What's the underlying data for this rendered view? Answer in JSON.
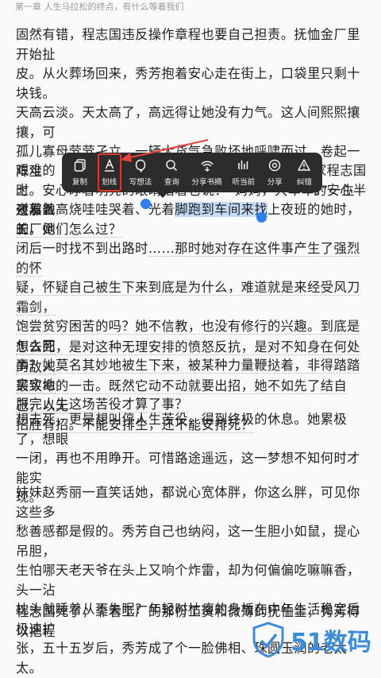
{
  "header": {
    "title": "第一章 人生马拉松的终点，有什么等着我们"
  },
  "paragraphs": [
    "固然有错，程志国违反操作章程也要自己担责。抚恤金厂里开始扯皮。从火葬场回来，秀芳抱着安心走在街上，口袋里只剩十块钱。天高云淡。天太高了，高远得让她没有力气。这人间熙熙攘攘，可孤儿寡母茕茕孑立。一辆大货气急败坏地呼啸而过，卷起一阵尘土。安心睁着明亮的眼睛指着它说：“妈妈，大车车。”一生还那么长，她们怎么过？",
    "艰难的时刻……",
    "对着她的……",
    "夜发着高烧哇哇哭着、光着脚跑到车间来找上夜班的她时，工厂倒闭后一时找不到出路时……那时她对存在这件事产生了强烈的怀疑，怀疑自己被生下来到底是为什么，难道就是来经受风刀霜剑，饱尝贫穷困苦的吗？她不信教，也没有修行的兴趣。到底是怎么回事？她莫名其妙地被生下来，被某种力量鞭挞着，非得踏踏实实地服完人生这场苦役才算了事？",
    "想去死，是对这种无理安排的愤怒反抗，是对不知身在何处的敌人最致命的一击。既然它动不动就要出招，她不如先了结自己，以无招胜有招。不能安排生，还不能安排死？",
    "想去死，更是想叫停人生苦役，得到终极的休息。她累极了，想眼一闭，再也不用睁开。可惜路途遥远，这一梦想不知何时才能实现。",
    "妹妹赵秀丽一直笑话她，都说心宽体胖，你这么胖，可见你这些多愁善感都是假的。秀芳自己也纳闷，这一生胆小如鼠，提心吊胆，生怕哪天老天爷在头上又响个炸雷，却为何偏偏吃嘛嘛香，头一沾枕头就睡着从不失眠？年轻时枯瘦的身板在中年生活稳定后极速扩张，五十五岁后，秀芳成了个一脸佛相、珠圆玉润的老太太。",
    "程志国死了，靠着工厂的那份工资和微薄的抚恤金，秀芳得以把程"
  ],
  "lines": {
    "p1": [
      "固然有错，程志国违反操作章程也要自己担责。抚恤金厂里开始扯",
      "皮。从火葬场回来，秀芳抱着安心走在街上，口袋里只剩十块钱。",
      "天高云淡。天太高了，高远得让她没有力气。这人间熙熙攘攘，可",
      "孤儿寡母茕茕孑立。一辆大货气急败坏地呼啸而过，卷起一阵尘",
      "土。安心睁着明亮的眼睛指着它说：“妈妈，大车车。”一生还那么",
      "长，她们怎么过？"
    ],
    "p2_left": [
      "艰难的时",
      "对着她的"
    ],
    "p2_right": [
      "家程志国",
      "的安心半"
    ],
    "p2": [
      "夜发着高烧哇哇哭着、光着",
      "脚跑到车间来找",
      "上夜班的她时，工厂倒",
      "闭后一时找不到出路时",
      "……那时她对存在这件事产生了强烈的怀",
      "疑，怀疑自己被生下来到底是为什么，难道就是来经受风刀霜剑，",
      "饱尝贫穷困苦的吗？她不信教，也没有修行的兴趣。到底是怎么回",
      "事？她莫名其妙地被生下来，被某种力量鞭挞着，非得踏踏实实地",
      "服完人生这场苦役才算了事？"
    ],
    "p3": [
      "想去死，是对这种无理安排的愤怒反抗，是对不知身在何处的敌人",
      "最致命的一击。既然它动不动就要出招，她不如先了结自己，以无",
      "招胜有招。不能安排生，还不能安排死？"
    ],
    "p4": [
      "想去死，更是想叫停人生苦役，得到终极的休息。她累极了，想眼",
      "一闭，再也不用睁开。可惜路途遥远，这一梦想不知何时才能实",
      "现。"
    ],
    "p5": [
      "妹妹赵秀丽一直笑话她，都说心宽体胖，你这么胖，可见你这些多",
      "愁善感都是假的。秀芳自己也纳闷，这一生胆小如鼠，提心吊胆，",
      "生怕哪天老天爷在头上又响个炸雷，却为何偏偏吃嘛嘛香，头一沾",
      "枕头就睡着从不失眠？年轻时枯瘦的身板在中年生活稳定后极速扩",
      "张，五十五岁后，秀芳成了个一脸佛相、珠圆玉润的老太太。"
    ],
    "p6": [
      "程志国死了，靠着工厂的那份工资和微薄的抚恤金，秀芳得以把程"
    ]
  },
  "toolbar": {
    "items": [
      {
        "label": "复制",
        "icon": "copy-icon"
      },
      {
        "label": "划线",
        "icon": "underline-icon"
      },
      {
        "label": "写想法",
        "icon": "thought-icon"
      },
      {
        "label": "查询",
        "icon": "search-icon"
      },
      {
        "label": "分享书摘",
        "icon": "share-quote-icon"
      },
      {
        "label": "听当前",
        "icon": "listen-icon"
      },
      {
        "label": "分享",
        "icon": "share-icon"
      },
      {
        "label": "纠错",
        "icon": "warning-icon"
      }
    ]
  },
  "watermark": {
    "text": "51数码"
  }
}
